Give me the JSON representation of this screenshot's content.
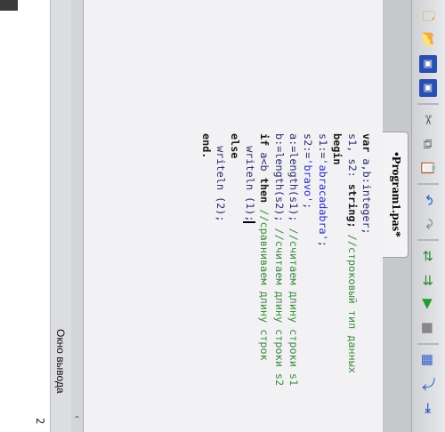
{
  "tab": {
    "title": "•Program1.pas*"
  },
  "toolbar": {
    "icons": [
      "new-file-icon",
      "open-folder-icon",
      "save-icon",
      "save-all-icon",
      "cut-icon",
      "copy-icon",
      "paste-icon",
      "undo-icon",
      "redo-icon",
      "run-icon",
      "stop-icon",
      "compile-icon",
      "debug-icon",
      "step-over-icon",
      "step-into-icon"
    ]
  },
  "code": {
    "l1_kw": "var",
    "l1_rest": " a,b:integer;",
    "l2_id": "s1, s2: ",
    "l2_kw": "string;",
    "l2_cm": " //строковый тип данных",
    "l3_kw": "begin",
    "l4_id": "s1:=",
    "l4_str": "'abracadabra'",
    "l4_end": ";",
    "l5_id": "s2:=",
    "l5_str": "'bravo'",
    "l5_end": ";",
    "l6_id": "a:=length(s1); ",
    "l6_cm": "//считаем длину строки s1",
    "l7_id": "b:=length(s2); ",
    "l7_cm": "//считаем длину строки s2",
    "l8_kw1": "if",
    "l8_id": " a<b ",
    "l8_kw2": "then",
    "l8_cm": " //сравниваем длину строк",
    "l9_id": "  writeln (1);",
    "l10_kw": "else",
    "l11_id": "  writeln (2);",
    "l12_kw": "end."
  },
  "output": {
    "title": "Окно вывода",
    "text": "2"
  }
}
